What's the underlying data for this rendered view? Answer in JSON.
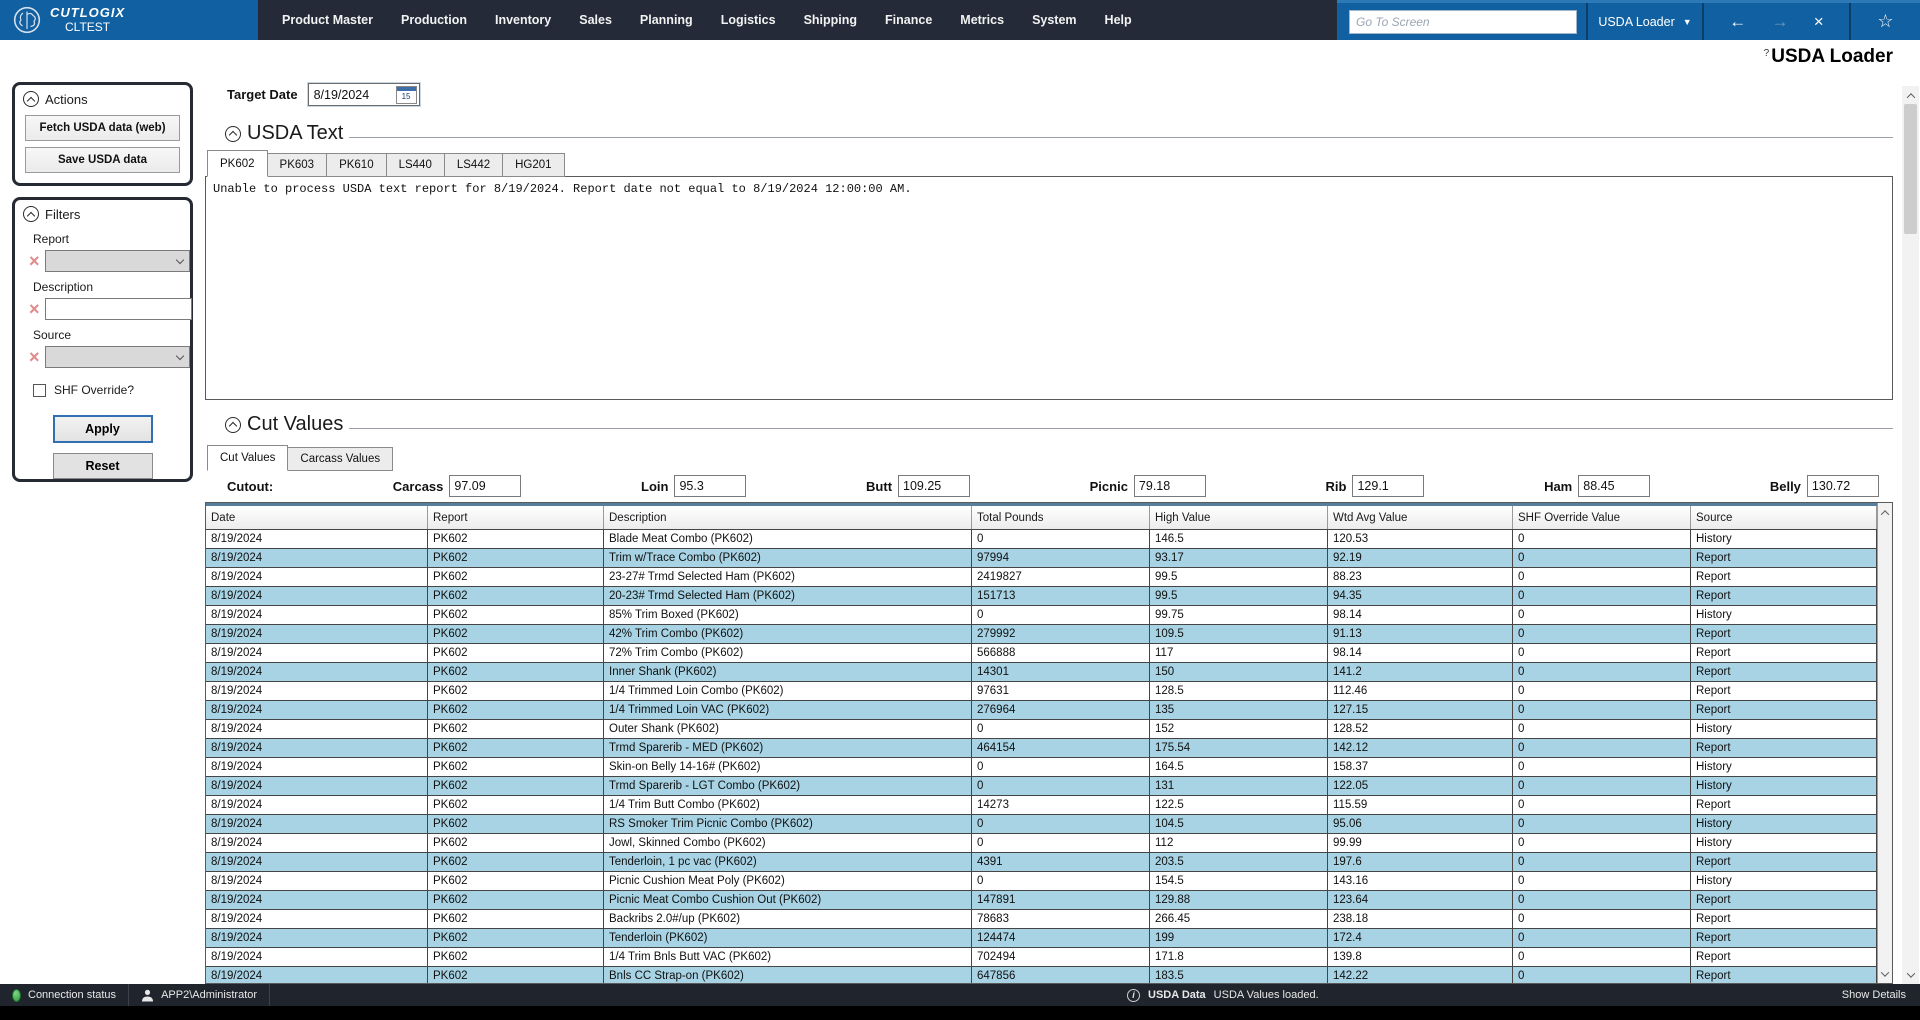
{
  "colors": {
    "topbar_bg": "#252a38",
    "accent_blue": "#1160a1",
    "statusbar_bg": "#20242d",
    "row_alt_blue": "#a7d3e4",
    "connection_green": "#2f9e3f"
  },
  "topbar": {
    "brand": "CUTLOGIX",
    "environment": "CLTEST",
    "menus": [
      "Product Master",
      "Production",
      "Inventory",
      "Sales",
      "Planning",
      "Logistics",
      "Shipping",
      "Finance",
      "Metrics",
      "System",
      "Help"
    ],
    "goto_placeholder": "Go To Screen",
    "screen_selector_value": "USDA Loader"
  },
  "page": {
    "help_glyph": "?",
    "title": "USDA Loader"
  },
  "actions_panel": {
    "title": "Actions",
    "fetch_button": "Fetch USDA data (web)",
    "save_button": "Save USDA data"
  },
  "filters_panel": {
    "title": "Filters",
    "report_label": "Report",
    "description_label": "Description",
    "description_value": "",
    "source_label": "Source",
    "shf_override_label": "SHF Override?",
    "apply_button": "Apply",
    "reset_button": "Reset",
    "clear_glyph": "×"
  },
  "target_date": {
    "label": "Target Date",
    "value": "8/19/2024",
    "calendar_day": "15"
  },
  "usda_text": {
    "section_title": "USDA Text",
    "tabs": [
      "PK602",
      "PK603",
      "PK610",
      "LS440",
      "LS442",
      "HG201"
    ],
    "active_tab": "PK602",
    "report_text": "Unable to process USDA text report for  8/19/2024. Report date not equal to 8/19/2024 12:00:00 AM."
  },
  "cut_values": {
    "section_title": "Cut Values",
    "tabs": [
      "Cut Values",
      "Carcass Values"
    ],
    "active_tab": "Cut Values",
    "cutout_label": "Cutout:",
    "cutout_fields": [
      {
        "label": "Carcass",
        "value": "97.09"
      },
      {
        "label": "Loin",
        "value": "95.3"
      },
      {
        "label": "Butt",
        "value": "109.25"
      },
      {
        "label": "Picnic",
        "value": "79.18"
      },
      {
        "label": "Rib",
        "value": "129.1"
      },
      {
        "label": "Ham",
        "value": "88.45"
      },
      {
        "label": "Belly",
        "value": "130.72"
      }
    ],
    "grid": {
      "columns": [
        "Date",
        "Report",
        "Description",
        "Total Pounds",
        "High Value",
        "Wtd Avg Value",
        "SHF Override Value",
        "Source"
      ],
      "column_keys": [
        "date",
        "report",
        "description",
        "total-pounds",
        "high-value",
        "wtd-avg-value",
        "shf-override-value",
        "source"
      ],
      "rows": [
        [
          "8/19/2024",
          "PK602",
          "Blade Meat Combo (PK602)",
          "0",
          "146.5",
          "120.53",
          "0",
          "History"
        ],
        [
          "8/19/2024",
          "PK602",
          "Trim w/Trace Combo (PK602)",
          "97994",
          "93.17",
          "92.19",
          "0",
          "Report"
        ],
        [
          "8/19/2024",
          "PK602",
          "23-27# Trmd Selected Ham (PK602)",
          "2419827",
          "99.5",
          "88.23",
          "0",
          "Report"
        ],
        [
          "8/19/2024",
          "PK602",
          "20-23# Trmd Selected Ham (PK602)",
          "151713",
          "99.5",
          "94.35",
          "0",
          "Report"
        ],
        [
          "8/19/2024",
          "PK602",
          "85% Trim Boxed (PK602)",
          "0",
          "99.75",
          "98.14",
          "0",
          "History"
        ],
        [
          "8/19/2024",
          "PK602",
          "42% Trim Combo (PK602)",
          "279992",
          "109.5",
          "91.13",
          "0",
          "Report"
        ],
        [
          "8/19/2024",
          "PK602",
          "72% Trim Combo (PK602)",
          "566888",
          "117",
          "98.14",
          "0",
          "Report"
        ],
        [
          "8/19/2024",
          "PK602",
          "Inner Shank (PK602)",
          "14301",
          "150",
          "141.2",
          "0",
          "Report"
        ],
        [
          "8/19/2024",
          "PK602",
          "1/4 Trimmed Loin Combo (PK602)",
          "97631",
          "128.5",
          "112.46",
          "0",
          "Report"
        ],
        [
          "8/19/2024",
          "PK602",
          "1/4 Trimmed Loin VAC (PK602)",
          "276964",
          "135",
          "127.15",
          "0",
          "Report"
        ],
        [
          "8/19/2024",
          "PK602",
          "Outer Shank (PK602)",
          "0",
          "152",
          "128.52",
          "0",
          "History"
        ],
        [
          "8/19/2024",
          "PK602",
          "Trmd Sparerib - MED (PK602)",
          "464154",
          "175.54",
          "142.12",
          "0",
          "Report"
        ],
        [
          "8/19/2024",
          "PK602",
          "Skin-on Belly 14-16# (PK602)",
          "0",
          "164.5",
          "158.37",
          "0",
          "History"
        ],
        [
          "8/19/2024",
          "PK602",
          "Trmd Sparerib - LGT Combo (PK602)",
          "0",
          "131",
          "122.05",
          "0",
          "History"
        ],
        [
          "8/19/2024",
          "PK602",
          "1/4 Trim Butt Combo (PK602)",
          "14273",
          "122.5",
          "115.59",
          "0",
          "Report"
        ],
        [
          "8/19/2024",
          "PK602",
          "RS Smoker Trim Picnic Combo (PK602)",
          "0",
          "104.5",
          "95.06",
          "0",
          "History"
        ],
        [
          "8/19/2024",
          "PK602",
          "Jowl, Skinned Combo (PK602)",
          "0",
          "112",
          "99.99",
          "0",
          "History"
        ],
        [
          "8/19/2024",
          "PK602",
          "Tenderloin, 1 pc vac (PK602)",
          "4391",
          "203.5",
          "197.6",
          "0",
          "Report"
        ],
        [
          "8/19/2024",
          "PK602",
          "Picnic Cushion Meat Poly (PK602)",
          "0",
          "154.5",
          "143.16",
          "0",
          "History"
        ],
        [
          "8/19/2024",
          "PK602",
          "Picnic Meat Combo Cushion Out (PK602)",
          "147891",
          "129.88",
          "123.64",
          "0",
          "Report"
        ],
        [
          "8/19/2024",
          "PK602",
          "Backribs 2.0#/up (PK602)",
          "78683",
          "266.45",
          "238.18",
          "0",
          "Report"
        ],
        [
          "8/19/2024",
          "PK602",
          "Tenderloin (PK602)",
          "124474",
          "199",
          "172.4",
          "0",
          "Report"
        ],
        [
          "8/19/2024",
          "PK602",
          "1/4 Trim Bnls Butt VAC (PK602)",
          "702494",
          "171.8",
          "139.8",
          "0",
          "Report"
        ],
        [
          "8/19/2024",
          "PK602",
          "Bnls CC Strap-on (PK602)",
          "647856",
          "183.5",
          "142.22",
          "0",
          "Report"
        ]
      ]
    }
  },
  "status_bar": {
    "connection_label": "Connection status",
    "user": "APP2\\Administrator",
    "info_title": "USDA Data",
    "info_message": "USDA Values loaded.",
    "show_details": "Show Details"
  }
}
